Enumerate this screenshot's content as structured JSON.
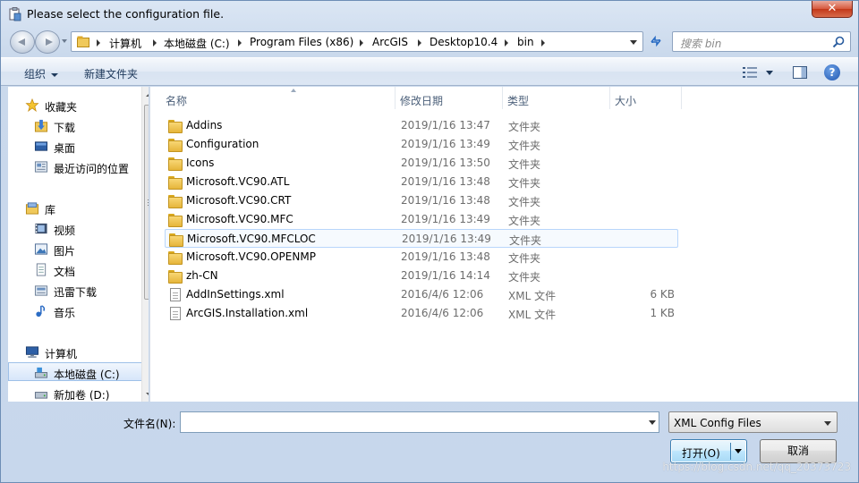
{
  "window": {
    "title": "Please select the configuration file.",
    "close_label": "✕"
  },
  "address": {
    "crumbs": [
      "计算机",
      "本地磁盘 (C:)",
      "Program Files (x86)",
      "ArcGIS",
      "Desktop10.4",
      "bin"
    ]
  },
  "search": {
    "placeholder": "搜索 bin"
  },
  "toolbar": {
    "organize": "组织",
    "new_folder": "新建文件夹",
    "help_label": "?"
  },
  "nav": {
    "favorites": "收藏夹",
    "downloads": "下载",
    "desktop": "桌面",
    "recent": "最近访问的位置",
    "libraries": "库",
    "videos": "视频",
    "pictures": "图片",
    "documents": "文档",
    "xunlei": "迅雷下载",
    "music": "音乐",
    "computer": "计算机",
    "local_c": "本地磁盘 (C:)",
    "volume_d": "新加卷 (D:)"
  },
  "columns": {
    "name": "名称",
    "date": "修改日期",
    "type": "类型",
    "size": "大小"
  },
  "files": [
    {
      "name": "Addins",
      "date": "2019/1/16 13:47",
      "type": "文件夹",
      "size": "",
      "icon": "folder-icon"
    },
    {
      "name": "Configuration",
      "date": "2019/1/16 13:49",
      "type": "文件夹",
      "size": "",
      "icon": "folder-icon"
    },
    {
      "name": "Icons",
      "date": "2019/1/16 13:50",
      "type": "文件夹",
      "size": "",
      "icon": "folder-icon"
    },
    {
      "name": "Microsoft.VC90.ATL",
      "date": "2019/1/16 13:48",
      "type": "文件夹",
      "size": "",
      "icon": "folder-icon"
    },
    {
      "name": "Microsoft.VC90.CRT",
      "date": "2019/1/16 13:48",
      "type": "文件夹",
      "size": "",
      "icon": "folder-icon"
    },
    {
      "name": "Microsoft.VC90.MFC",
      "date": "2019/1/16 13:49",
      "type": "文件夹",
      "size": "",
      "icon": "folder-icon"
    },
    {
      "name": "Microsoft.VC90.MFCLOC",
      "date": "2019/1/16 13:49",
      "type": "文件夹",
      "size": "",
      "icon": "folder-icon"
    },
    {
      "name": "Microsoft.VC90.OPENMP",
      "date": "2019/1/16 13:48",
      "type": "文件夹",
      "size": "",
      "icon": "folder-icon"
    },
    {
      "name": "zh-CN",
      "date": "2019/1/16 14:14",
      "type": "文件夹",
      "size": "",
      "icon": "folder-icon"
    },
    {
      "name": "AddInSettings.xml",
      "date": "2016/4/6 12:06",
      "type": "XML 文件",
      "size": "6 KB",
      "icon": "xml-file-icon"
    },
    {
      "name": "ArcGIS.Installation.xml",
      "date": "2016/4/6 12:06",
      "type": "XML 文件",
      "size": "1 KB",
      "icon": "xml-file-icon"
    }
  ],
  "bottom": {
    "filename_label": "文件名(N):",
    "filename_value": "",
    "filter_value": "XML Config Files",
    "open_label": "打开(O)",
    "cancel_label": "取消"
  },
  "watermark": "https://blog.csdn.net/qq_20373723"
}
